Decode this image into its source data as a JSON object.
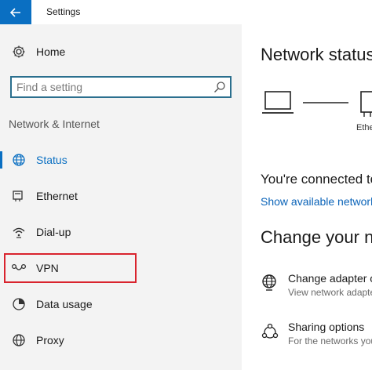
{
  "window": {
    "title": "Settings"
  },
  "sidebar": {
    "home_label": "Home",
    "search_placeholder": "Find a setting",
    "section_label": "Network & Internet",
    "items": [
      {
        "label": "Status",
        "icon": "globe-icon",
        "active": true
      },
      {
        "label": "Ethernet",
        "icon": "ethernet-icon"
      },
      {
        "label": "Dial-up",
        "icon": "dialup-icon"
      },
      {
        "label": "VPN",
        "icon": "vpn-icon",
        "highlighted": true
      },
      {
        "label": "Data usage",
        "icon": "data-usage-icon"
      },
      {
        "label": "Proxy",
        "icon": "proxy-globe-icon"
      }
    ]
  },
  "main": {
    "title": "Network status",
    "diagram": {
      "label": "Ethernet"
    },
    "connected_text": "You're connected to the Internet",
    "show_networks_link": "Show available networks",
    "change_title": "Change your network settings",
    "options": [
      {
        "title": "Change adapter options",
        "subtitle": "View network adapters and change connection settings."
      },
      {
        "title": "Sharing options",
        "subtitle": "For the networks you connect to, decide what you want to share."
      }
    ]
  },
  "colors": {
    "accent": "#0a6fc2",
    "highlight_border": "#d9232d",
    "link": "#0a63b8",
    "sidebar_bg": "#f3f3f3"
  }
}
